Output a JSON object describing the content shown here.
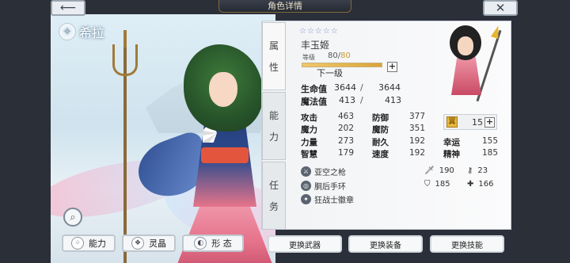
{
  "header": {
    "title": "角色详情",
    "back_icon": "arrow-left-icon",
    "close_icon": "close-x-icon"
  },
  "artwork": {
    "name": "希拉",
    "search_icon": "magnifier-icon"
  },
  "side_tabs": [
    {
      "label_1": "属",
      "label_2": "性"
    },
    {
      "label_1": "能",
      "label_2": "力"
    },
    {
      "label_1": "任",
      "label_2": "务"
    }
  ],
  "character": {
    "stars": "☆☆☆☆☆",
    "name": "丰玉姬",
    "level_label": "等级",
    "level": "80",
    "level_max": "80",
    "level_separator": "/",
    "exp_fraction": 1.0,
    "next_level": "下一级",
    "plus": "+"
  },
  "vitals": {
    "hp_label": "生命值",
    "hp": "3644",
    "hp_max": "3644",
    "mp_label": "魔法值",
    "mp": "413",
    "mp_max": "413",
    "separator": "/"
  },
  "stats": {
    "atk_label": "攻击",
    "atk": "463",
    "def_label": "防御",
    "def": "377",
    "mag_label": "魔力",
    "mag": "202",
    "mdef_label": "魔防",
    "mdef": "351",
    "str_label": "力量",
    "str": "273",
    "end_label": "耐久",
    "end": "192",
    "luck_label": "幸运",
    "luck": "155",
    "int_label": "智慧",
    "int": "179",
    "spd_label": "速度",
    "spd": "192",
    "spi_label": "精神",
    "spi": "185",
    "points_icon_text": "翼",
    "points": "15"
  },
  "equipment": [
    {
      "name": "亚空之枪",
      "icon": "spear-icon"
    },
    {
      "name": "胴后手环",
      "icon": "bracelet-icon"
    },
    {
      "name": "狂战士徽章",
      "icon": "badge-icon"
    }
  ],
  "equip_stats": {
    "sword": "190",
    "key": "23",
    "shield": "185",
    "cross": "166"
  },
  "bottom_tabs": [
    {
      "label": "能力",
      "icon": "dots-icon"
    },
    {
      "label": "灵晶",
      "icon": "crystal-icon"
    },
    {
      "label": "形 态",
      "icon": "form-icon"
    }
  ],
  "actions": [
    {
      "label": "更换武器"
    },
    {
      "label": "更换装备"
    },
    {
      "label": "更换技能"
    }
  ]
}
